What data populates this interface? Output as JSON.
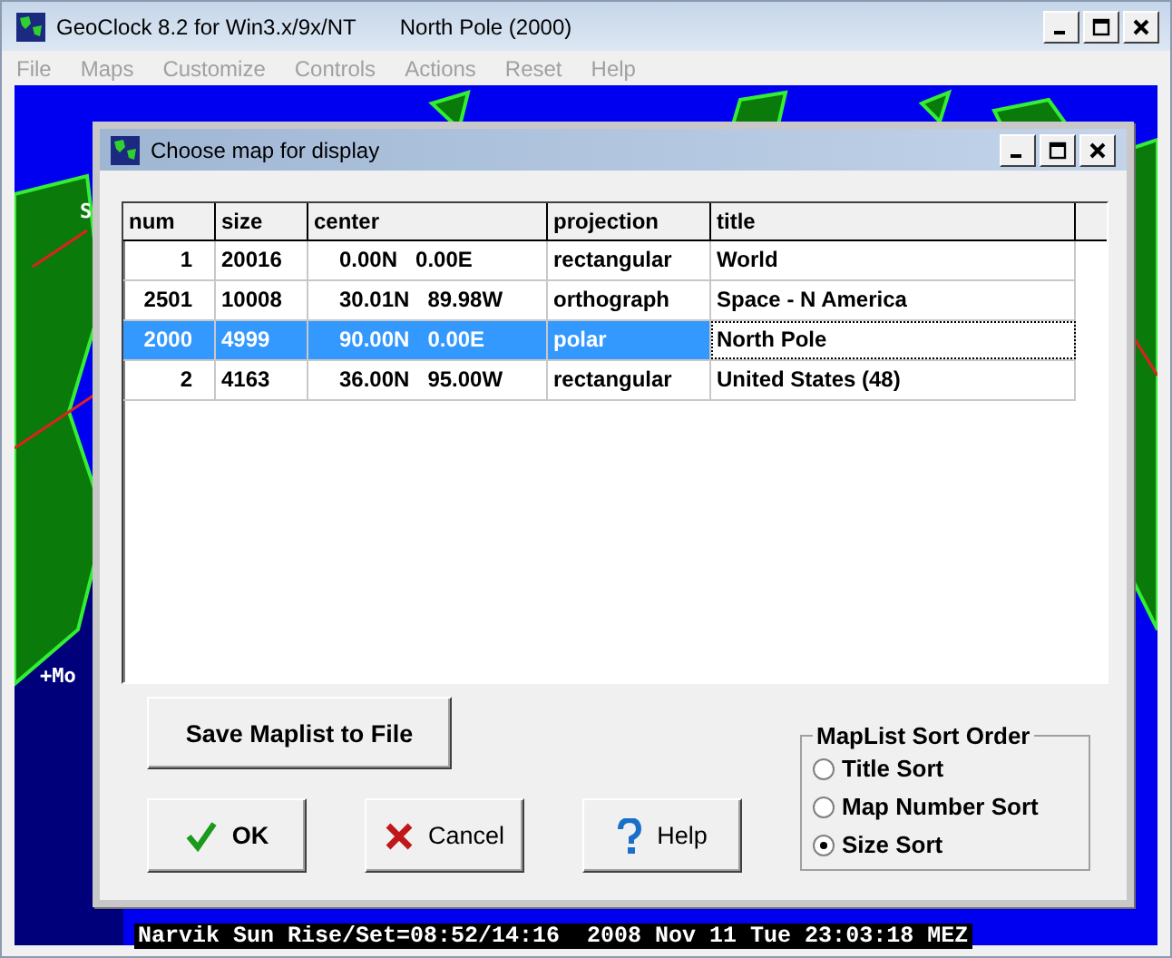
{
  "window": {
    "title": "GeoClock 8.2 for Win3.x/9x/NT",
    "subtitle": "North Pole  (2000)"
  },
  "menu": [
    {
      "label": "File",
      "disabled": true
    },
    {
      "label": "Maps",
      "disabled": true
    },
    {
      "label": "Customize",
      "disabled": true
    },
    {
      "label": "Controls",
      "disabled": true
    },
    {
      "label": "Actions",
      "disabled": true
    },
    {
      "label": "Reset",
      "disabled": true
    },
    {
      "label": "Help",
      "disabled": true
    }
  ],
  "map": {
    "labels": [
      "S",
      "+Mo"
    ]
  },
  "dialog": {
    "title": "Choose map for display",
    "table": {
      "columns": [
        "num",
        "size",
        "center",
        "projection",
        "title"
      ],
      "rows": [
        {
          "num": "1",
          "size": "20016",
          "center": [
            "0.00N",
            "0.00E"
          ],
          "projection": "rectangular",
          "title": "World",
          "selected": false
        },
        {
          "num": "2501",
          "size": "10008",
          "center": [
            "30.01N",
            "89.98W"
          ],
          "projection": "orthograph",
          "title": "Space - N America",
          "selected": false
        },
        {
          "num": "2000",
          "size": "4999",
          "center": [
            "90.00N",
            "0.00E"
          ],
          "projection": "polar",
          "title": "North Pole",
          "selected": true
        },
        {
          "num": "2",
          "size": "4163",
          "center": [
            "36.00N",
            "95.00W"
          ],
          "projection": "rectangular",
          "title": "United States (48)",
          "selected": false
        }
      ]
    },
    "save_button": "Save Maplist to File",
    "buttons": [
      {
        "label": "OK",
        "kind": "ok"
      },
      {
        "label": "Cancel",
        "kind": "cancel"
      },
      {
        "label": "Help",
        "kind": "help"
      }
    ],
    "sort_group": {
      "title": "MapList Sort Order",
      "options": [
        {
          "label": "Title Sort",
          "selected": false
        },
        {
          "label": "Map Number Sort",
          "selected": false
        },
        {
          "label": "Size Sort",
          "selected": true
        }
      ]
    }
  },
  "status_bar": "Narvik Sun Rise/Set=08:52/14:16  2008 Nov 11 Tue 23:03:18 MEZ"
}
